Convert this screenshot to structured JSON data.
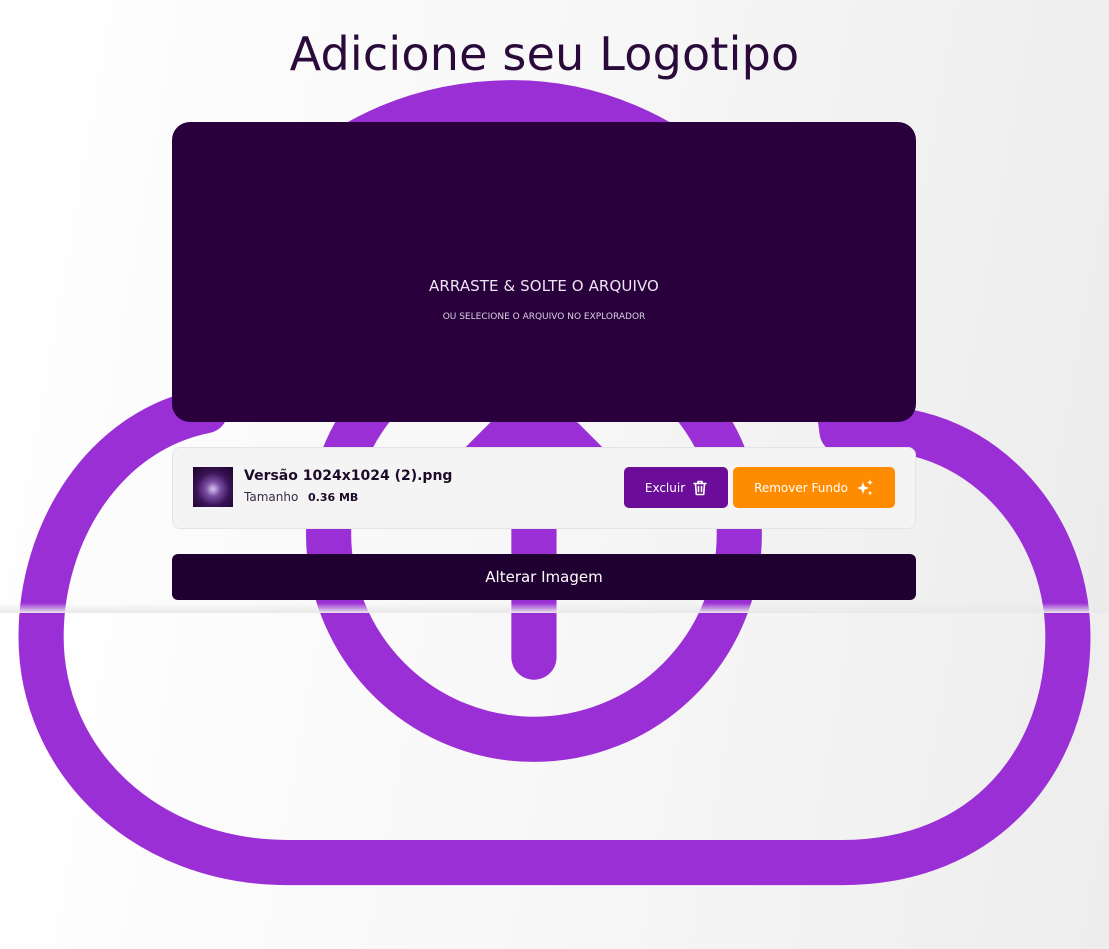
{
  "page": {
    "title": "Adicione seu Logotipo"
  },
  "dropzone": {
    "icon": "cloud-upload-icon",
    "main_text": "ARRASTE & SOLTE O ARQUIVO",
    "sub_text": "OU SELECIONE O ARQUIVO NO EXPLORADOR",
    "background_color": "#29003b",
    "icon_color": "#9b2fd6"
  },
  "file": {
    "name": "Versão 1024x1024 (2).png",
    "size_label": "Tamanho",
    "size_value": "0.36 MB",
    "delete_label": "Excluir",
    "delete_icon": "trash-icon",
    "remove_bg_label": "Remover Fundo",
    "remove_bg_icon": "sparkles-icon"
  },
  "footer": {
    "change_label": "Alterar Imagem"
  },
  "colors": {
    "title": "#2a0a3a",
    "delete_button": "#6c0d99",
    "remove_button": "#ff8c00",
    "change_button": "#1f0030"
  }
}
